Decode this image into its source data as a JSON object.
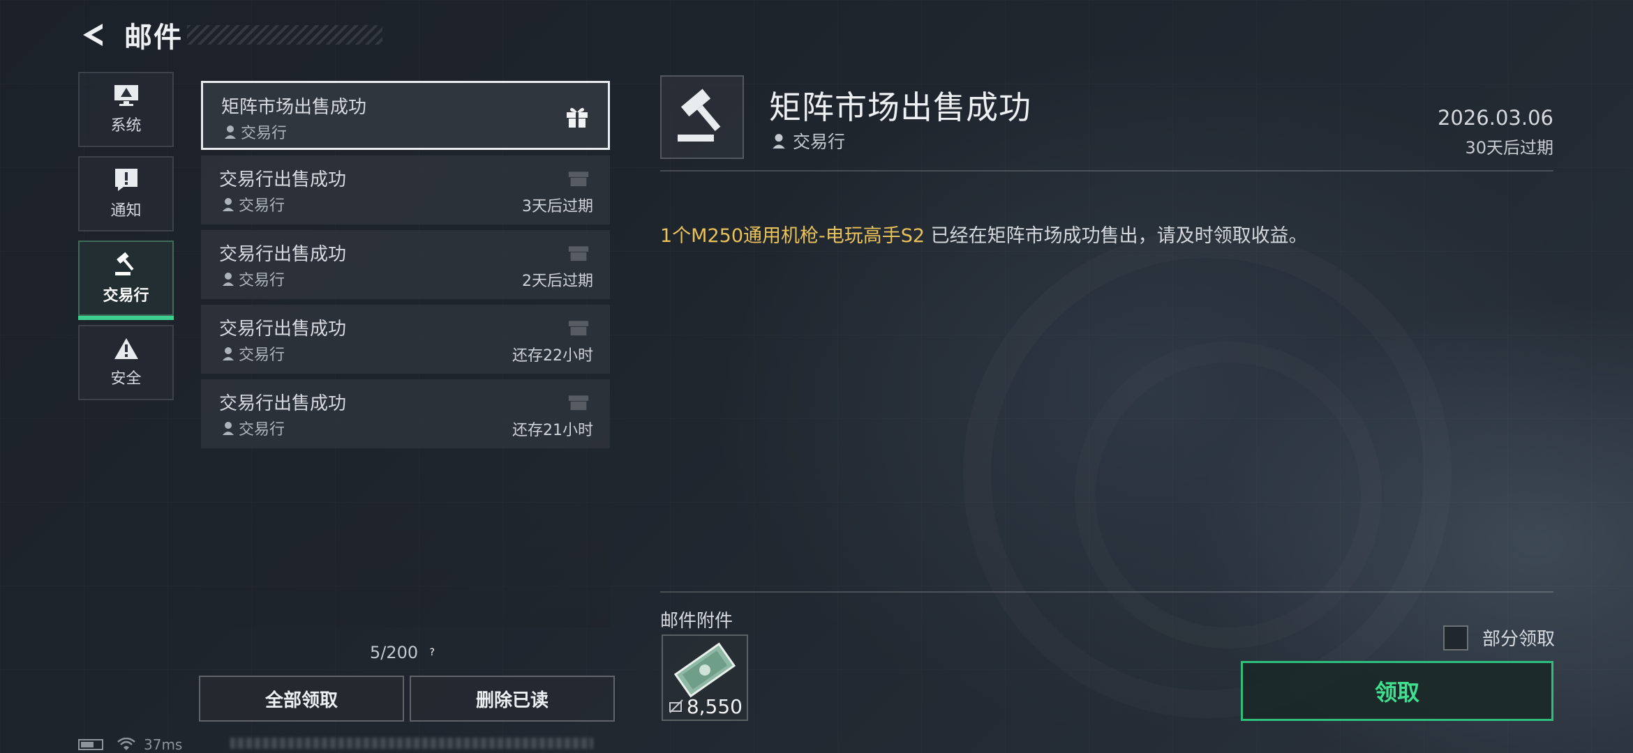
{
  "header": {
    "title": "邮件"
  },
  "categories": [
    {
      "label": "系统",
      "icon": "monitor-icon",
      "active": false
    },
    {
      "label": "通知",
      "icon": "exclamation-icon",
      "active": false
    },
    {
      "label": "交易行",
      "icon": "gavel-icon",
      "active": true
    },
    {
      "label": "安全",
      "icon": "warning-icon",
      "active": false
    }
  ],
  "mails": [
    {
      "subject": "矩阵市场出售成功",
      "sender": "交易行",
      "expire": "",
      "selected": true
    },
    {
      "subject": "交易行出售成功",
      "sender": "交易行",
      "expire": "3天后过期",
      "selected": false
    },
    {
      "subject": "交易行出售成功",
      "sender": "交易行",
      "expire": "2天后过期",
      "selected": false
    },
    {
      "subject": "交易行出售成功",
      "sender": "交易行",
      "expire": "还存22小时",
      "selected": false
    },
    {
      "subject": "交易行出售成功",
      "sender": "交易行",
      "expire": "还存21小时",
      "selected": false
    }
  ],
  "list_footer": {
    "counter": "5/200",
    "help": "?",
    "claim_all": "全部领取",
    "delete_read": "删除已读"
  },
  "detail": {
    "title": "矩阵市场出售成功",
    "sender": "交易行",
    "date": "2026.03.06",
    "expire": "30天后过期",
    "body_highlight": "1个M250通用机枪-电玩高手S2",
    "body_text": " 已经在矩阵市场成功售出，请及时领取收益。",
    "attachments_title": "邮件附件",
    "attachment": {
      "icon": "cash-icon",
      "quantity": "8,550"
    },
    "partial_claim": "部分领取",
    "claim": "领取"
  },
  "status_bar": {
    "ping": "37ms"
  },
  "colors": {
    "accent_green": "#3fe08f",
    "highlight_gold": "#e9c25a",
    "background": "#1f252d"
  }
}
